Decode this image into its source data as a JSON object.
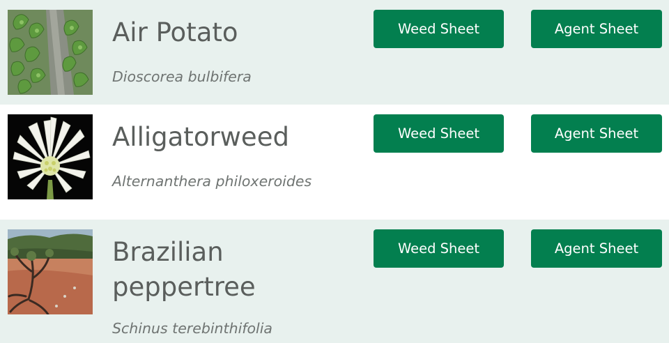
{
  "entries": [
    {
      "common_name": "Air Potato",
      "scientific_name": "Dioscorea bulbifera",
      "image_icon": "air-potato-photo",
      "weed_sheet_label": "Weed Sheet",
      "agent_sheet_label": "Agent Sheet"
    },
    {
      "common_name": "Alligatorweed",
      "scientific_name": "Alternanthera philoxeroides",
      "image_icon": "alligatorweed-photo",
      "weed_sheet_label": "Weed Sheet",
      "agent_sheet_label": "Agent Sheet"
    },
    {
      "common_name": "Brazilian peppertree",
      "scientific_name": "Schinus terebinthifolia",
      "image_icon": "brazilian-peppertree-photo",
      "weed_sheet_label": "Weed Sheet",
      "agent_sheet_label": "Agent Sheet"
    }
  ],
  "colors": {
    "row_tint": "#e8f1ee",
    "button_green": "#037f4f",
    "name_text": "#5a5e5c",
    "scientific_text": "#6f7472"
  }
}
